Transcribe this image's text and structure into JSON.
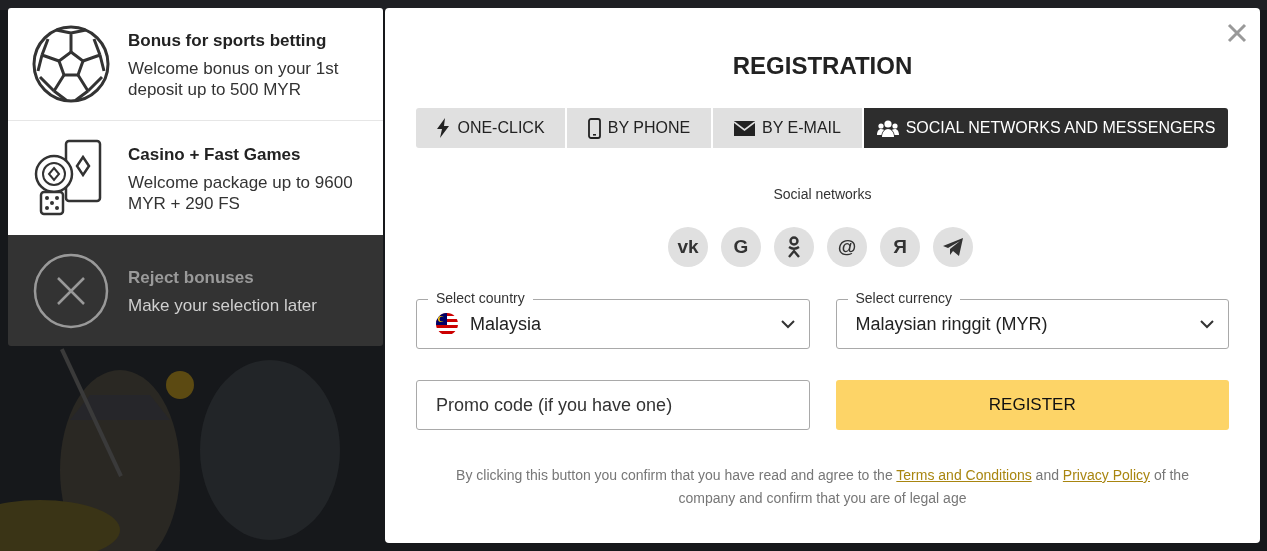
{
  "bonuses": [
    {
      "kind": "sports",
      "title": "Bonus for sports betting",
      "description": "Welcome bonus on your 1st deposit up to 500 MYR"
    },
    {
      "kind": "casino",
      "title": "Casino + Fast Games",
      "description": "Welcome package up to 9600 MYR + 290 FS"
    },
    {
      "kind": "reject",
      "title": "Reject bonuses",
      "description": "Make your selection later"
    }
  ],
  "registration": {
    "title": "REGISTRATION",
    "tabs": [
      {
        "label": "ONE-CLICK",
        "selected": false
      },
      {
        "label": "BY PHONE",
        "selected": false
      },
      {
        "label": "BY E-MAIL",
        "selected": false
      },
      {
        "label": "SOCIAL NETWORKS AND MESSENGERS",
        "selected": true
      }
    ],
    "social_label": "Social networks",
    "social_networks": [
      {
        "kind": "glyph",
        "glyph": "vk"
      },
      {
        "kind": "glyph",
        "glyph": "G"
      },
      {
        "kind": "ok"
      },
      {
        "kind": "glyph",
        "glyph": "@"
      },
      {
        "kind": "glyph",
        "glyph": "Я"
      },
      {
        "kind": "telegram"
      }
    ],
    "country": {
      "label": "Select country",
      "value": "Malaysia"
    },
    "currency": {
      "label": "Select currency",
      "value": "Malaysian ringgit (MYR)"
    },
    "promo": {
      "placeholder": "Promo code (if you have one)"
    },
    "register_button": "REGISTER",
    "disclaimer": [
      {
        "text": "By clicking this button you confirm that you have read and agree to the "
      },
      {
        "text": "Terms and Conditions",
        "link": true
      },
      {
        "text": " and "
      },
      {
        "text": "Privacy Policy",
        "link": true
      },
      {
        "text": " of the company and confirm that you are of legal age"
      }
    ]
  }
}
